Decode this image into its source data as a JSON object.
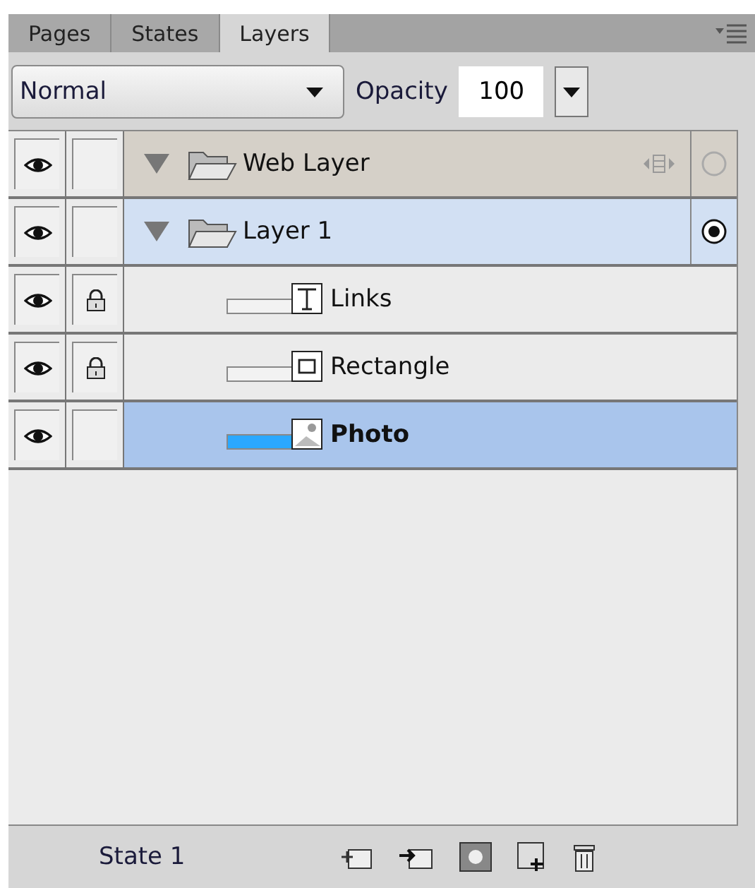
{
  "tabs": [
    {
      "label": "Pages",
      "selected": false
    },
    {
      "label": "States",
      "selected": false
    },
    {
      "label": "Layers",
      "selected": true
    }
  ],
  "blend_mode": {
    "value": "Normal"
  },
  "opacity": {
    "label": "Opacity",
    "value": "100"
  },
  "layers": [
    {
      "kind": "folder",
      "name": "Web Layer",
      "visible": true,
      "locked": false,
      "expanded": true,
      "selected": false,
      "web": true,
      "target": false
    },
    {
      "kind": "folder",
      "name": "Layer 1",
      "visible": true,
      "locked": false,
      "expanded": true,
      "selected": false,
      "web": false,
      "target": true
    },
    {
      "kind": "text",
      "name": "Links",
      "visible": true,
      "locked": true,
      "selected": false
    },
    {
      "kind": "rect",
      "name": "Rectangle",
      "visible": true,
      "locked": true,
      "selected": false
    },
    {
      "kind": "image",
      "name": "Photo",
      "visible": true,
      "locked": false,
      "selected": true
    }
  ],
  "status": {
    "state": "State 1"
  }
}
